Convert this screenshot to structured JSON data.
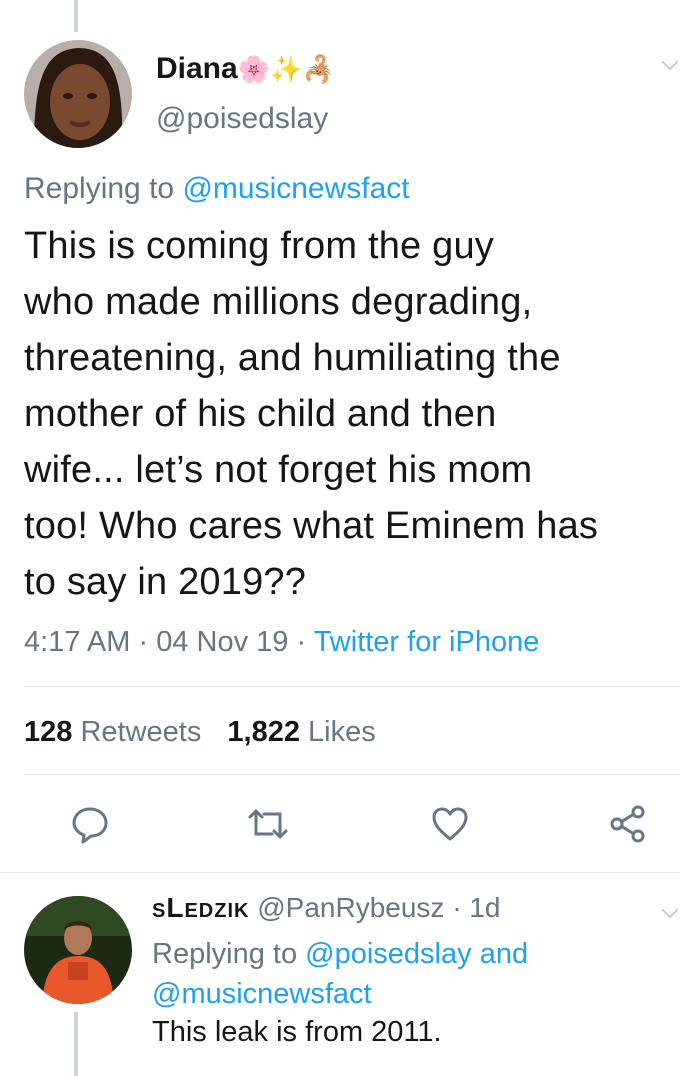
{
  "tweet": {
    "display_name": "Diana",
    "emojis": "🌸✨🦂",
    "handle": "@poisedslay",
    "replying_prefix": "Replying to",
    "replying_to": "@musicnewsfact",
    "text_lines": [
      "This is coming from the guy",
      "who made millions degrading,",
      "threatening, and humiliating the",
      "mother of his child and then",
      "wife... let’s not forget his mom",
      "too! Who cares what Eminem has",
      "to say in 2019??"
    ],
    "time": "4:17 AM",
    "sep": "·",
    "date": "04 Nov 19",
    "source": "Twitter for iPhone",
    "stats": {
      "retweets_count": "128",
      "retweets_label": "Retweets",
      "likes_count": "1,822",
      "likes_label": "Likes"
    },
    "actions": {
      "reply_icon": "reply-icon",
      "retweet_icon": "retweet-icon",
      "like_icon": "heart-icon",
      "share_icon": "share-icon"
    }
  },
  "reply": {
    "display_name": "sLedzik",
    "handle": "@PanRybeusz",
    "sep": "·",
    "age": "1d",
    "replying_prefix": "Replying to",
    "replying_to_1": "@poisedslay",
    "and_word": "and",
    "replying_to_2": "@musicnewsfact",
    "text": "This leak is from 2011."
  },
  "colors": {
    "link": "#1da1f2",
    "secondary": "#657786",
    "divider": "#e1e8ed",
    "thread_line": "#ccd6dd"
  }
}
